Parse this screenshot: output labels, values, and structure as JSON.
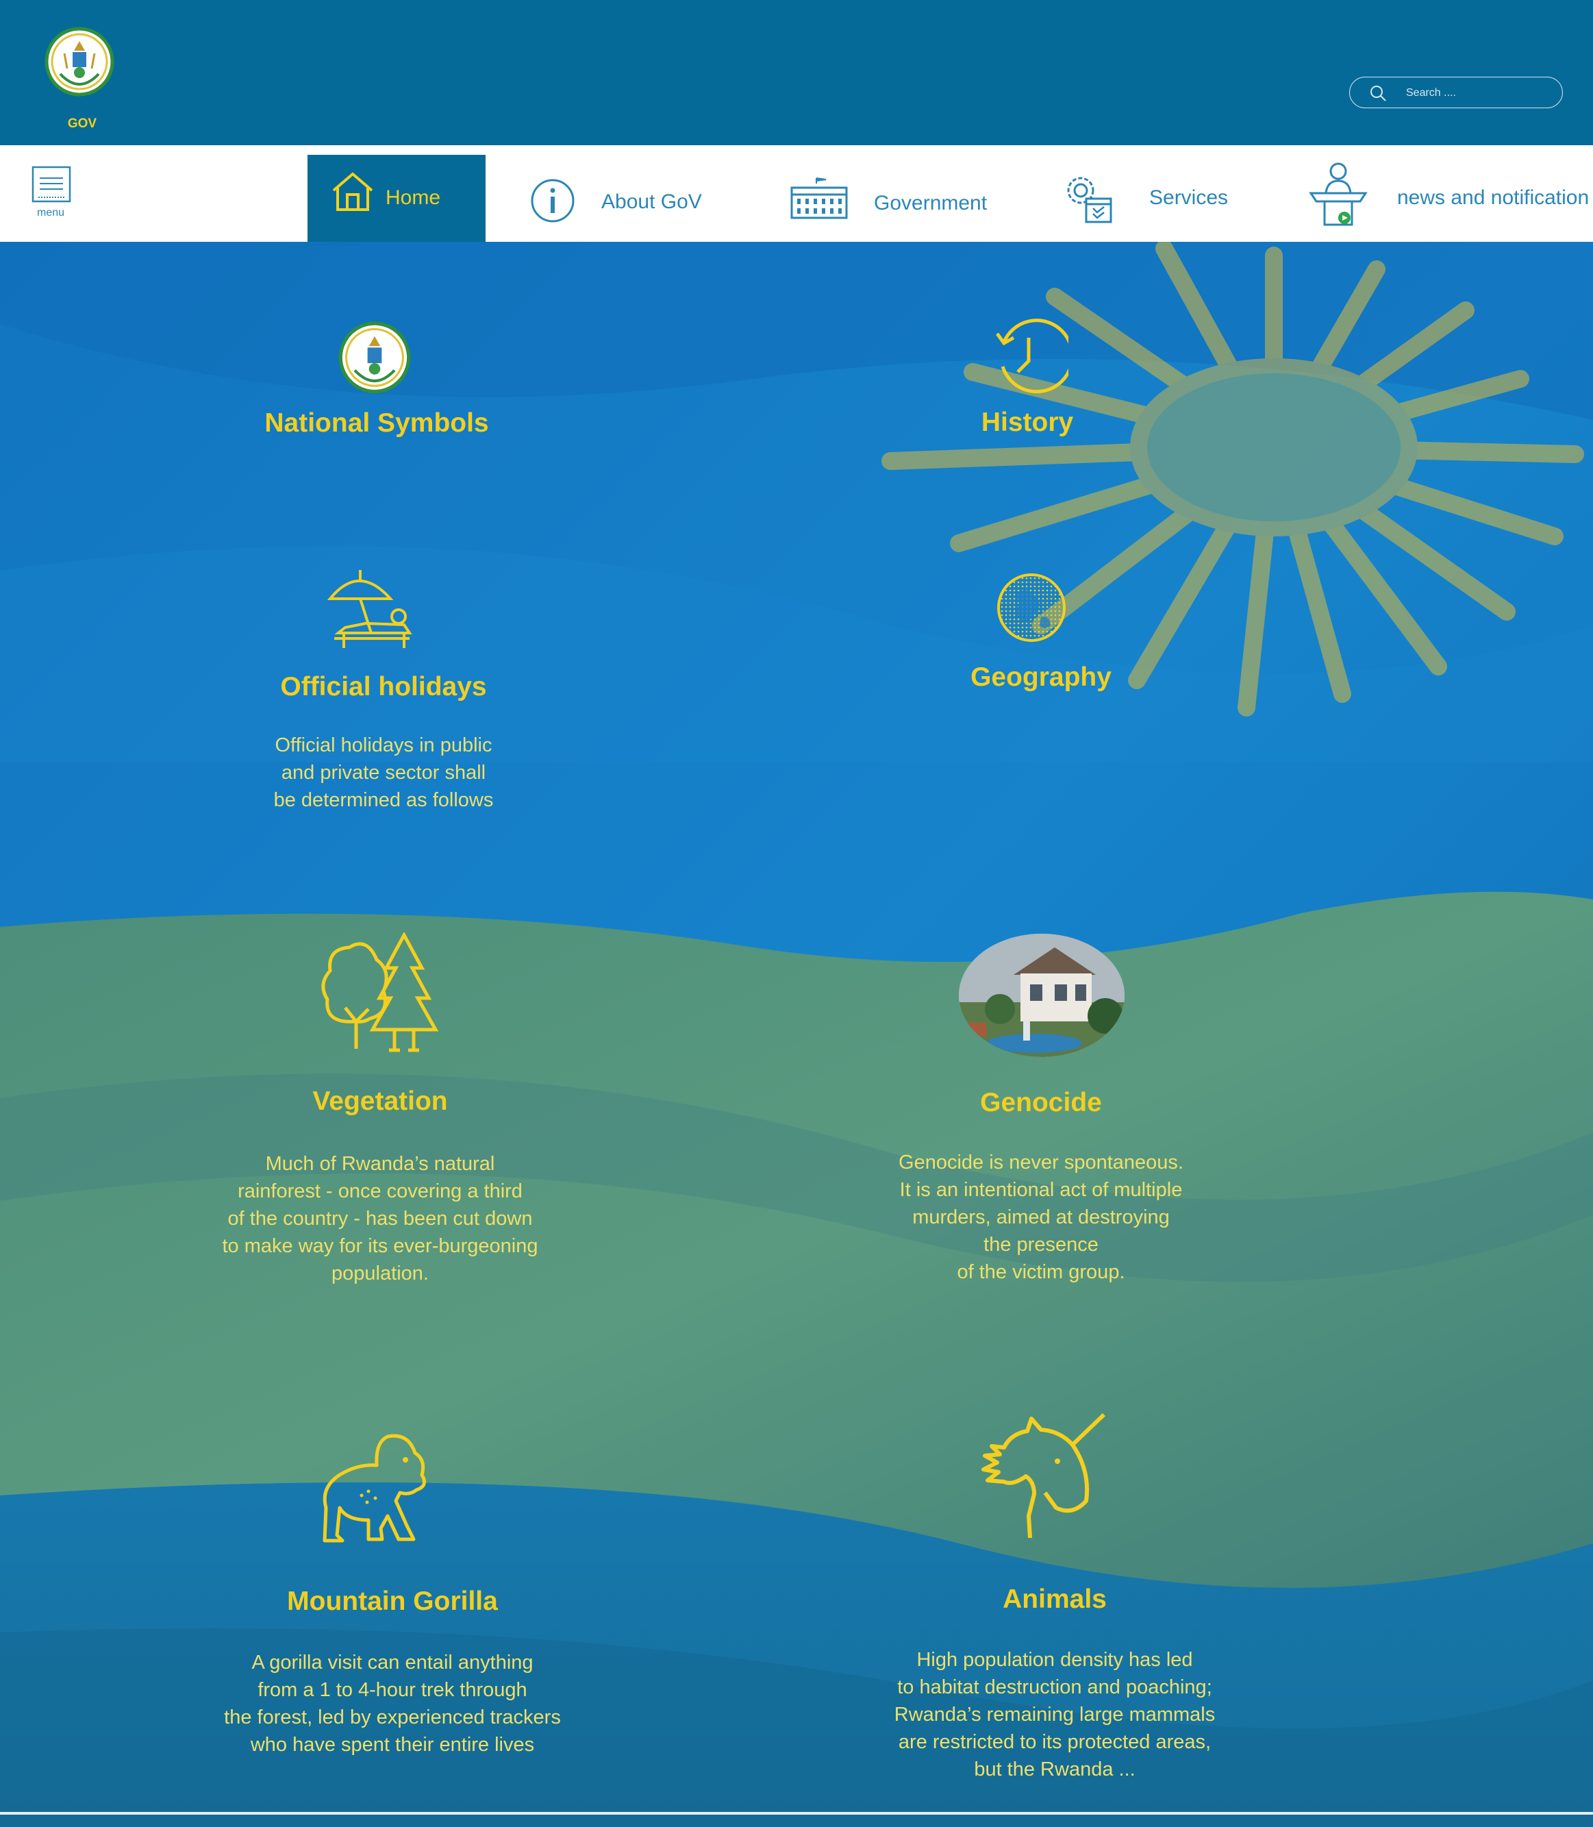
{
  "header": {
    "logo_text": "GOV",
    "search_placeholder": "Search ...."
  },
  "nav": {
    "menu_label": "menu",
    "items": [
      {
        "label": "Home",
        "icon": "home-icon",
        "active": true
      },
      {
        "label": "About GoV",
        "icon": "info-icon"
      },
      {
        "label": "Government",
        "icon": "government-building-icon"
      },
      {
        "label": "Services",
        "icon": "services-gear-icon"
      },
      {
        "label": "news and notification",
        "icon": "podium-speaker-icon"
      }
    ]
  },
  "colors": {
    "header_bg": "#066a98",
    "nav_text": "#2a86b6",
    "accent_yellow": "#f3cf1f",
    "flag_blue": "#0f74c0",
    "flag_green": "#4f8f77"
  },
  "cards": {
    "national_symbols": {
      "title": "National Symbols",
      "icon": "coat-of-arms-icon"
    },
    "history": {
      "title": "History",
      "icon": "clock-history-icon"
    },
    "official_holidays": {
      "title": "Official holidays",
      "icon": "beach-umbrella-icon",
      "desc": "Official holidays in public\n and private sector shall\n be determined as follows"
    },
    "geography": {
      "title": "Geography",
      "icon": "globe-icon"
    },
    "vegetation": {
      "title": "Vegetation",
      "icon": "trees-icon",
      "desc": "Much of Rwanda’s natural\nrainforest - once covering a third\nof the country - has been cut down\nto make way for its ever-burgeoning\npopulation."
    },
    "genocide": {
      "title": "Genocide",
      "icon": "memorial-photo",
      "desc": "Genocide is never spontaneous.\nIt is an intentional act of multiple\nmurders, aimed at destroying\nthe presence\nof the victim group."
    },
    "mountain_gorilla": {
      "title": "Mountain Gorilla",
      "icon": "gorilla-icon",
      "desc": "A gorilla visit can entail anything\nfrom a 1 to 4-hour trek through\nthe forest, led by experienced trackers\nwho have spent their entire lives"
    },
    "animals": {
      "title": "Animals",
      "icon": "unicorn-icon",
      "desc": "High population density has led\nto habitat destruction and poaching;\nRwanda’s remaining large mammals\nare restricted to its protected areas,\nbut the Rwanda ..."
    }
  }
}
